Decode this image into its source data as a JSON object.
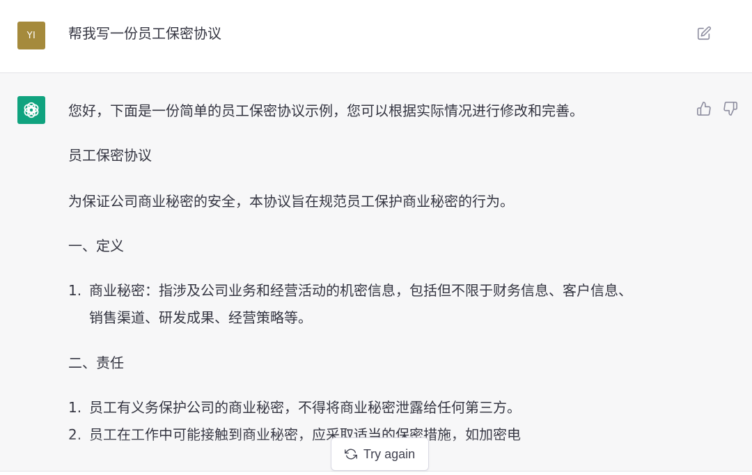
{
  "user": {
    "avatar_initials": "YI",
    "message": "帮我写一份员工保密协议"
  },
  "assistant": {
    "intro": "您好，下面是一份简单的员工保密协议示例，您可以根据实际情况进行修改和完善。",
    "title": "员工保密协议",
    "purpose": "为保证公司商业秘密的安全，本协议旨在规范员工保护商业秘密的行为。",
    "section1": {
      "heading": "一、定义",
      "items": [
        {
          "num": "1.",
          "line1": "商业秘密：指涉及公司业务和经营活动的机密信息，包括但不限于财务信息、客户信息、",
          "line2": "销售渠道、研发成果、经营策略等。"
        }
      ]
    },
    "section2": {
      "heading": "二、责任",
      "items": [
        {
          "num": "1.",
          "text": "员工有义务保护公司的商业秘密，不得将商业秘密泄露给任何第三方。"
        },
        {
          "num": "2.",
          "text": "员工在工作中可能接触到商业秘密，应采取适当的保密措施，如加密电"
        }
      ]
    }
  },
  "controls": {
    "try_again_label": "Try again"
  },
  "icons": {
    "edit": "edit-icon",
    "thumbs_up": "thumbs-up-icon",
    "thumbs_down": "thumbs-down-icon",
    "refresh": "refresh-icon",
    "openai_logo": "openai-logo-icon"
  },
  "colors": {
    "user_avatar": "#a58a3c",
    "assistant_avatar": "#10a37f",
    "assistant_bg": "#f7f7f8",
    "text": "#343541"
  }
}
